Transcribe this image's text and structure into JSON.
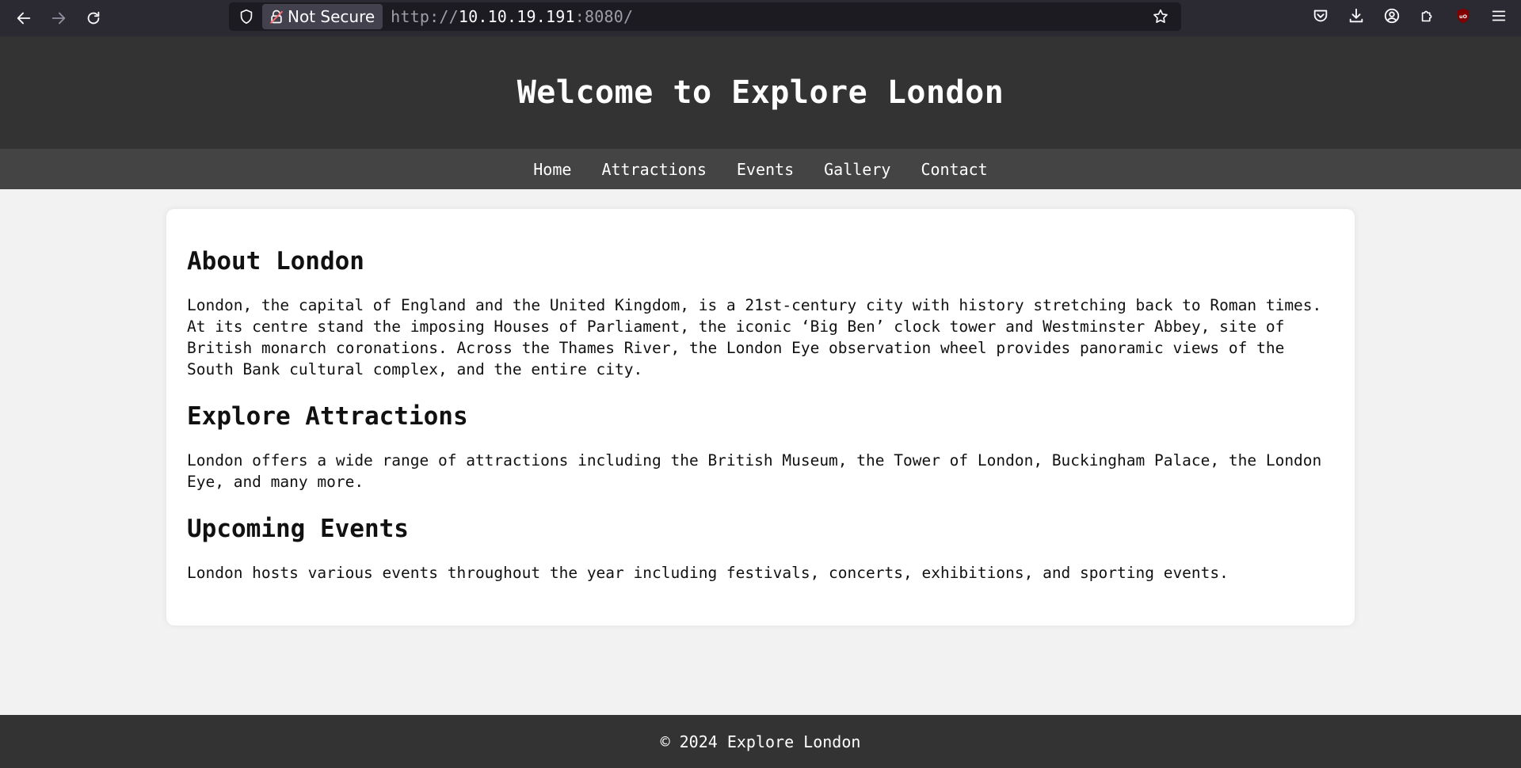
{
  "browser": {
    "security_label": "Not Secure",
    "url_scheme": "http://",
    "url_host": "10.10.19.191",
    "url_port": ":8080/",
    "icons": [
      "back-icon",
      "forward-icon",
      "reload-icon",
      "shield-icon",
      "lock-warning-icon",
      "bookmark-star-icon",
      "pocket-icon",
      "download-icon",
      "account-icon",
      "extensions-icon",
      "ublock-icon",
      "menu-icon"
    ]
  },
  "header": {
    "title": "Welcome to Explore London"
  },
  "nav": {
    "items": [
      {
        "label": "Home"
      },
      {
        "label": "Attractions"
      },
      {
        "label": "Events"
      },
      {
        "label": "Gallery"
      },
      {
        "label": "Contact"
      }
    ]
  },
  "main": {
    "sections": [
      {
        "heading": "About London",
        "text": "London, the capital of England and the United Kingdom, is a 21st-century city with history stretching back to Roman times. At its centre stand the imposing Houses of Parliament, the iconic ‘Big Ben’ clock tower and Westminster Abbey, site of British monarch coronations. Across the Thames River, the London Eye observation wheel provides panoramic views of the South Bank cultural complex, and the entire city."
      },
      {
        "heading": "Explore Attractions",
        "text": "London offers a wide range of attractions including the British Museum, the Tower of London, Buckingham Palace, the London Eye, and many more."
      },
      {
        "heading": "Upcoming Events",
        "text": "London hosts various events throughout the year including festivals, concerts, exhibitions, and sporting events."
      }
    ]
  },
  "footer": {
    "text": "© 2024 Explore London"
  },
  "colors": {
    "header_bg": "#333333",
    "nav_bg": "#444444",
    "page_bg": "#f2f2f2",
    "card_bg": "#ffffff",
    "browser_bg": "#2b2a33"
  }
}
